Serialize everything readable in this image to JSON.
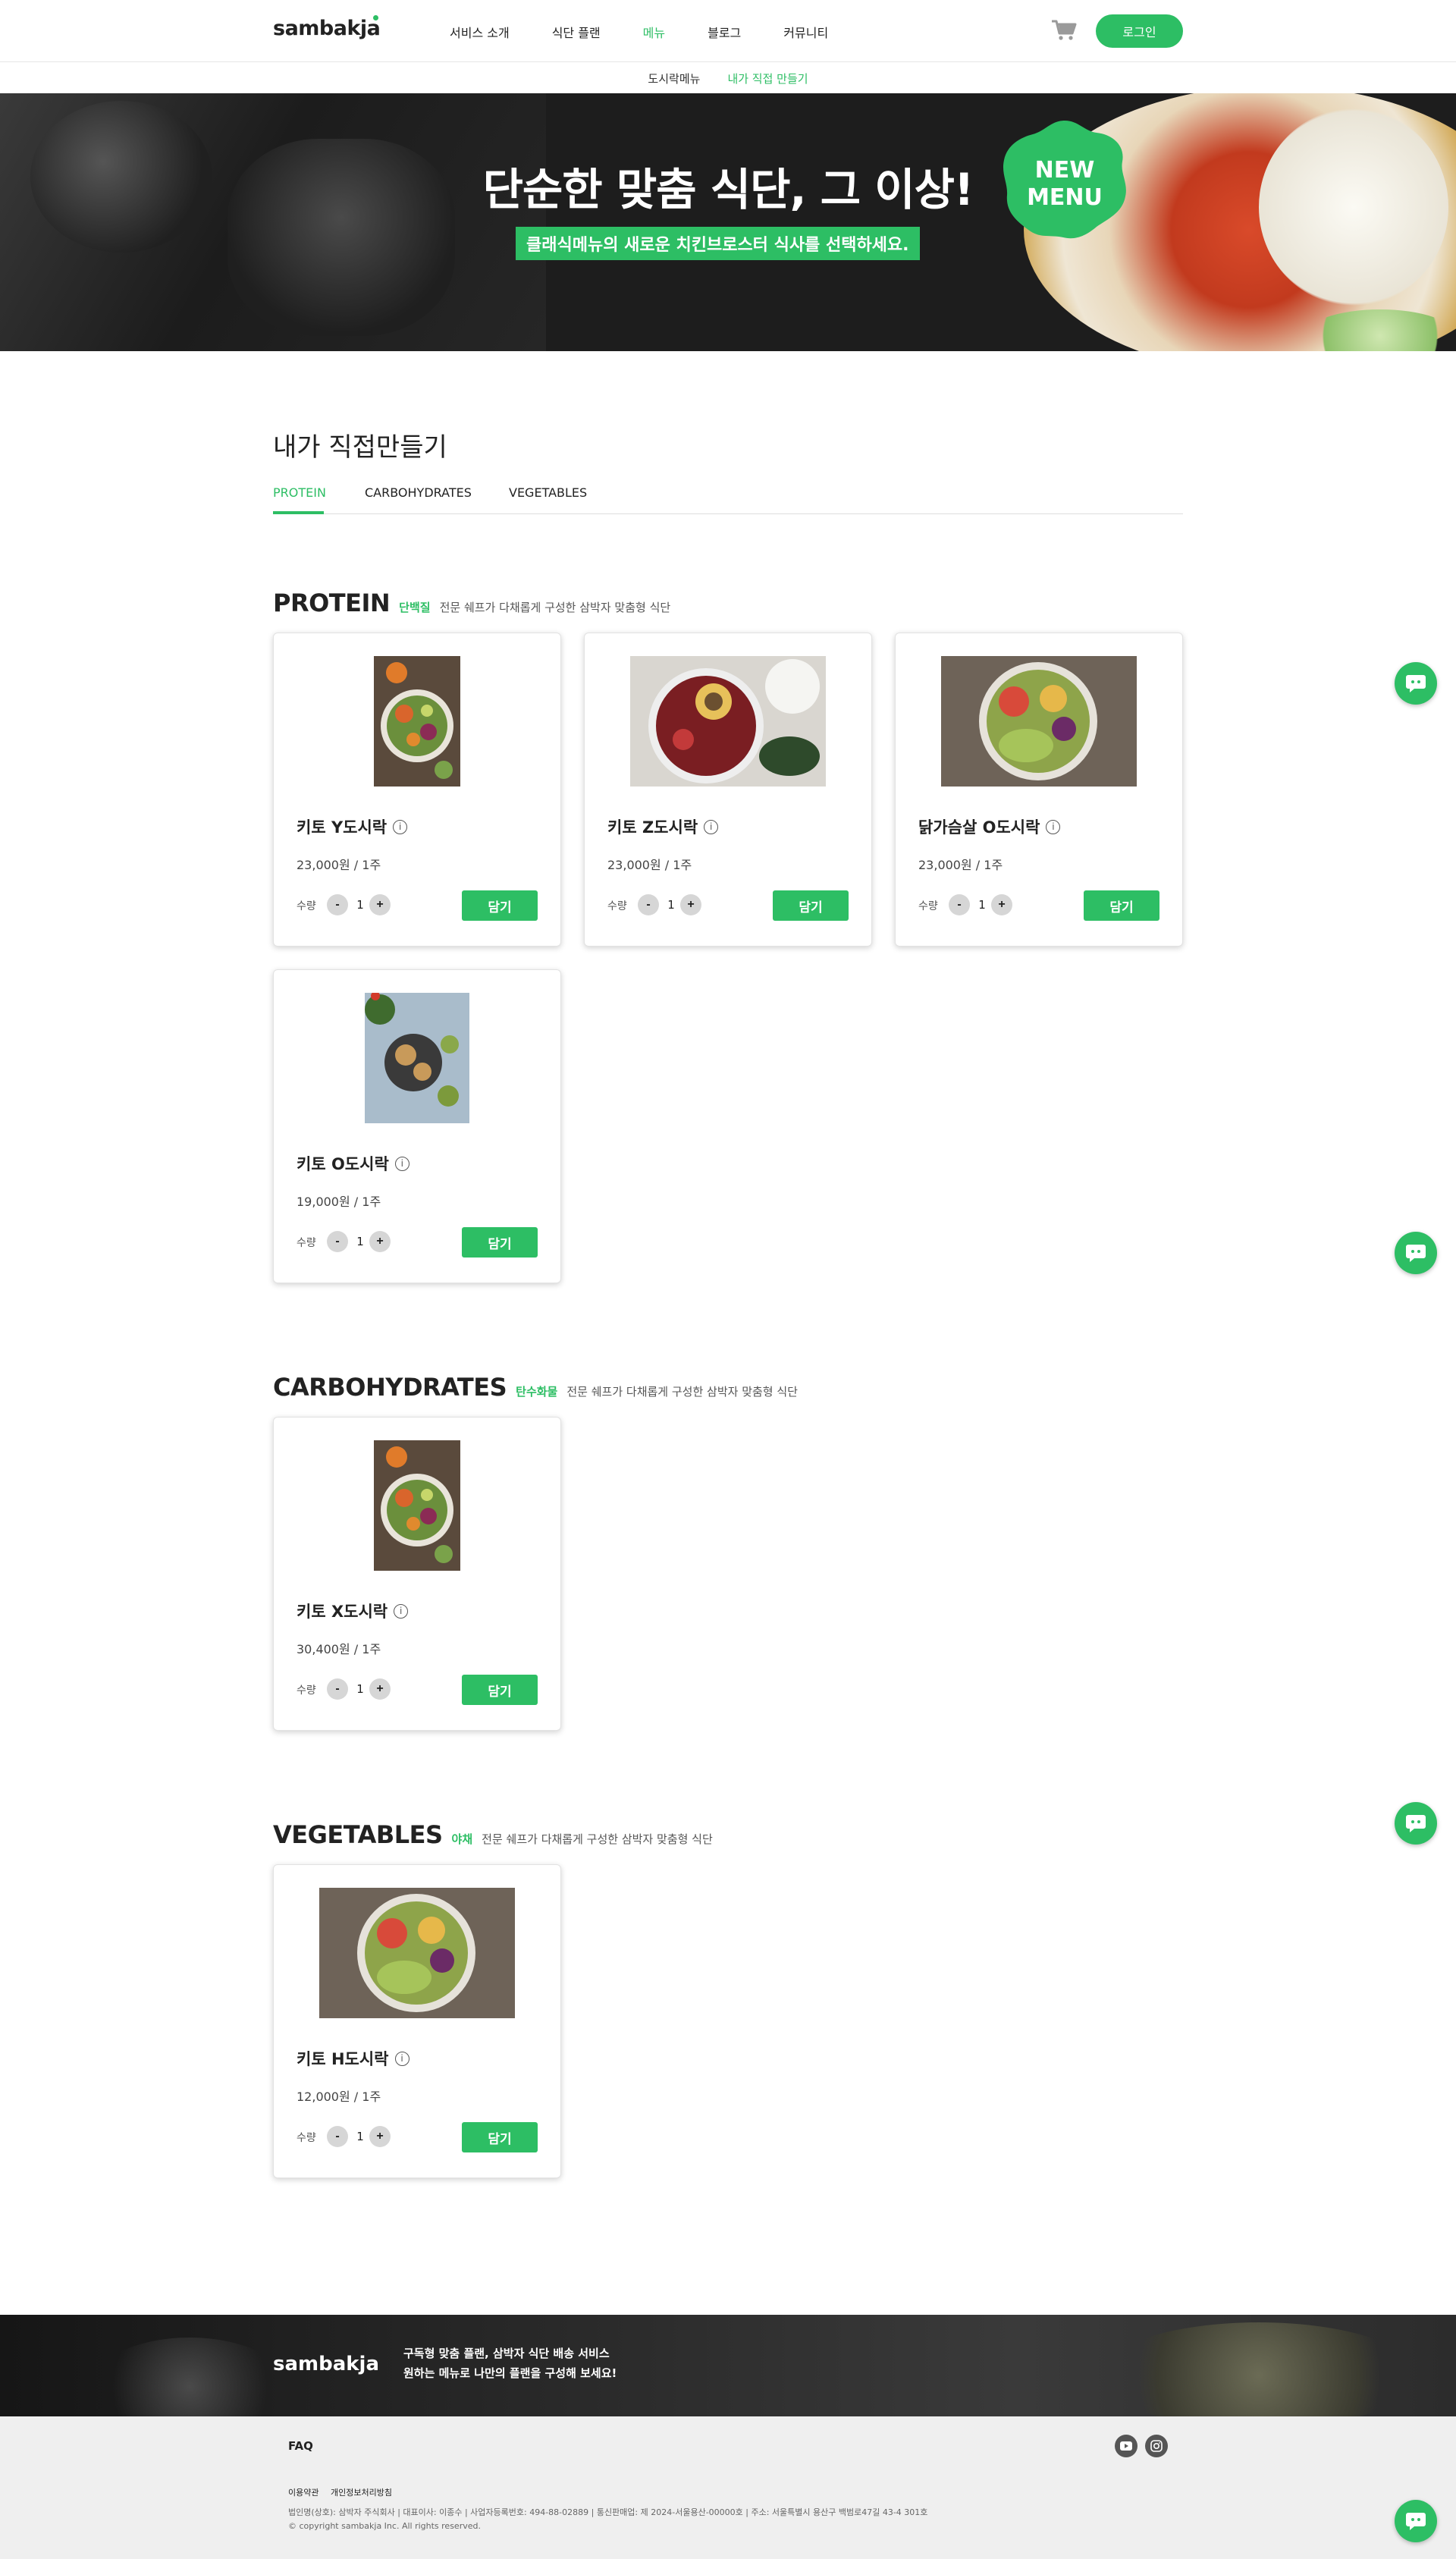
{
  "header": {
    "logo": "sambakja",
    "nav": [
      "서비스 소개",
      "식단 플랜",
      "메뉴",
      "블로그",
      "커뮤니티"
    ],
    "nav_active_index": 2,
    "login_label": "로그인"
  },
  "subnav": {
    "items": [
      "도시락메뉴",
      "내가 직접 만들기"
    ],
    "active_index": 1
  },
  "hero": {
    "title": "단순한 맞춤 식단, 그 이상!",
    "subtitle": "클래식메뉴의 새로운 치킨브로스터 식사를 선택하세요.",
    "badge_line1": "NEW",
    "badge_line2": "MENU"
  },
  "page": {
    "title": "내가 직접만들기",
    "tabs": [
      "PROTEIN",
      "CARBOHYDRATES",
      "VEGETABLES"
    ],
    "active_tab": 0
  },
  "categories": [
    {
      "title": "PROTEIN",
      "tag": "단백질",
      "desc": "전문 쉐프가 다채롭게 구성한 삼박자 맞춤형 식단",
      "items": [
        {
          "name": "키토 Y도시락",
          "price": "23,000원 / 1주",
          "qty": "1"
        },
        {
          "name": "키토 Z도시락",
          "price": "23,000원 / 1주",
          "qty": "1"
        },
        {
          "name": "닭가슴살 O도시락",
          "price": "23,000원 / 1주",
          "qty": "1"
        },
        {
          "name": "키토 O도시락",
          "price": "19,000원 / 1주",
          "qty": "1"
        }
      ]
    },
    {
      "title": "CARBOHYDRATES",
      "tag": "탄수화물",
      "desc": "전문 쉐프가 다채롭게 구성한 삼박자 맞춤형 식단",
      "items": [
        {
          "name": "키토 X도시락",
          "price": "30,400원 / 1주",
          "qty": "1"
        }
      ]
    },
    {
      "title": "VEGETABLES",
      "tag": "야채",
      "desc": "전문 쉐프가 다채롭게 구성한 삼박자 맞춤형 식단",
      "items": [
        {
          "name": "키토 H도시락",
          "price": "12,000원 / 1주",
          "qty": "1"
        }
      ]
    }
  ],
  "card_labels": {
    "qty_label": "수량",
    "minus": "-",
    "plus": "+",
    "add": "담기",
    "info": "i"
  },
  "footer": {
    "logo": "sambakja",
    "copy_line1": "구독형 맞춤 플랜, 삼박자 식단 배송 서비스",
    "copy_line2": "원하는 메뉴로 나만의 플랜을 구성해 보세요!",
    "faq": "FAQ",
    "links": [
      "이용약관",
      "개인정보처리방침"
    ],
    "company_info": "법인명(상호): 삼박자 주식회사 | 대표이사: 이종수 | 사업자등록번호: 494-88-02889 | 통신판매업: 제 2024-서울용산-00000호 | 주소: 서울특별시 용산구 백범로47길 43-4 301호",
    "copyright": "© copyright sambakja Inc. All rights reserved."
  },
  "colors": {
    "accent": "#2dbe64",
    "hero_bg": "#1d1d1d",
    "footer_bg": "#efefef"
  },
  "icons": [
    "cart-icon",
    "chat-icon",
    "info-icon",
    "youtube-icon",
    "instagram-icon"
  ]
}
